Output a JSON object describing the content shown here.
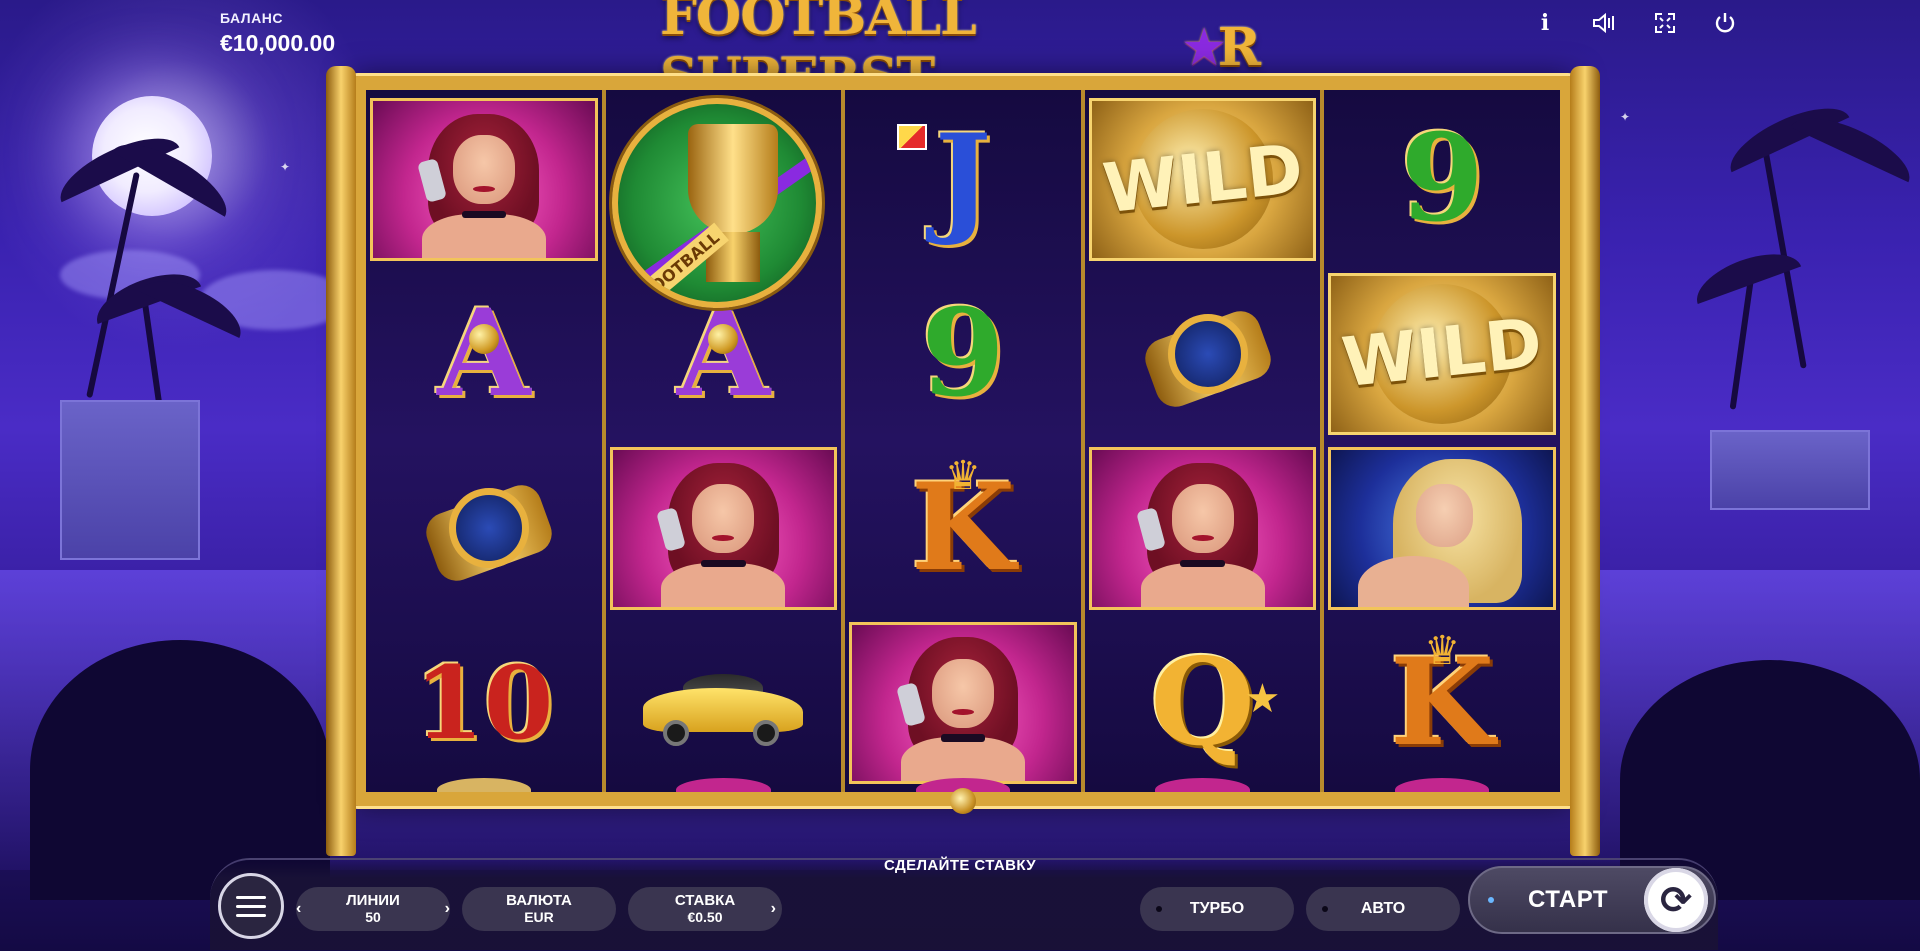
{
  "balance": {
    "label": "БАЛАНС",
    "value": "€10,000.00"
  },
  "logo": {
    "part1": "FOOTBALL SUPERST",
    "star": "★",
    "part2": "R"
  },
  "top_icons": [
    {
      "name": "info-icon",
      "glyph": "i"
    },
    {
      "name": "sound-icon",
      "glyph": "🔊︎"
    },
    {
      "name": "fullscreen-icon",
      "glyph": "⤢"
    },
    {
      "name": "power-icon",
      "glyph": "⏻"
    }
  ],
  "reels": [
    [
      "woman",
      "A",
      "watch",
      "10"
    ],
    [
      "trophy",
      "A",
      "woman",
      "car"
    ],
    [
      "J",
      "9",
      "K",
      "woman"
    ],
    [
      "WILD",
      "watch",
      "woman",
      "Q"
    ],
    [
      "9",
      "WILD",
      "blonde",
      "K"
    ]
  ],
  "symbols": {
    "wild": "WILD",
    "trophy_label": "FOOTBALL",
    "A": "A",
    "J": "J",
    "9": "9",
    "K": "K",
    "Q": "Q",
    "10": "10"
  },
  "controls": {
    "prompt": "СДЕЛАЙТЕ СТАВКУ",
    "lines_label": "ЛИНИИ",
    "lines_value": "50",
    "currency_label": "ВАЛЮТА",
    "currency_value": "EUR",
    "bet_label": "СТАВКА",
    "bet_value": "€0.50",
    "turbo": "ТУРБО",
    "auto": "АВТО",
    "start": "СТАРТ",
    "chevron_left": "‹",
    "chevron_right": "›",
    "spin_glyph": "⟳"
  },
  "colors": {
    "frame_gold": "#d9a63a",
    "background": "#3a22b0",
    "pill_bg": "#3a3550"
  }
}
